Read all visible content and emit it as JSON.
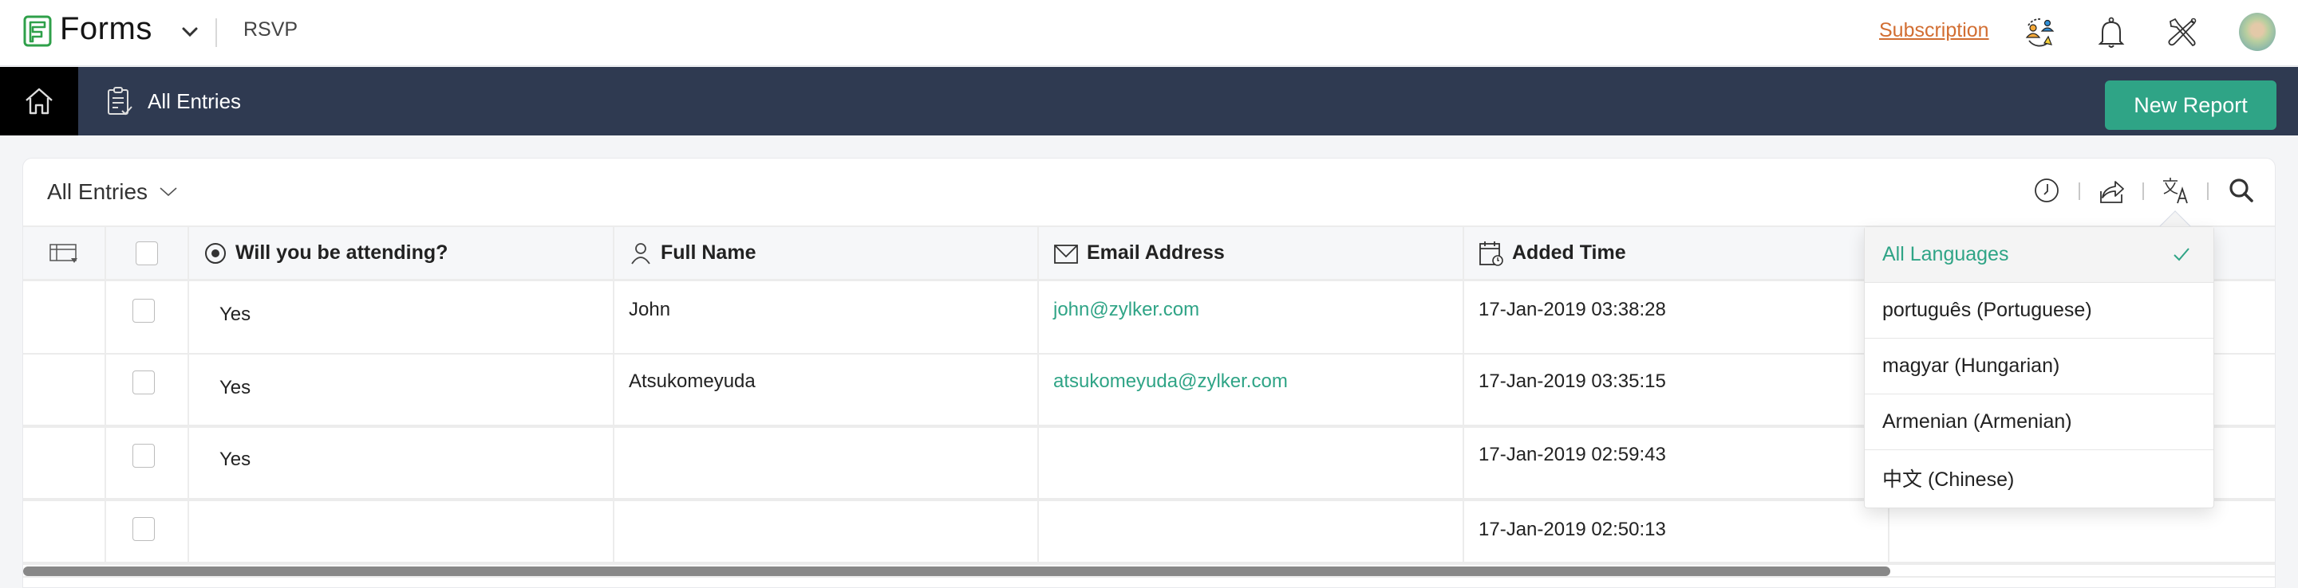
{
  "topbar": {
    "brand": "Forms",
    "form_name": "RSVP",
    "subscription_link": "Subscription",
    "icons": [
      "logo-icon",
      "chevron-down-icon",
      "user-switch-icon",
      "bell-icon",
      "tools-icon",
      "avatar"
    ]
  },
  "navbar": {
    "home_icon": "home-icon",
    "section_label": "All Entries",
    "section_icon": "clipboard-check-icon",
    "new_report_label": "New Report"
  },
  "card": {
    "view_title": "All Entries",
    "toolbar_icons": [
      "history-icon",
      "export-icon",
      "translate-icon",
      "search-icon"
    ]
  },
  "table": {
    "columns": [
      {
        "label": "Will you be attending?",
        "icon": "radio-icon"
      },
      {
        "label": "Full Name",
        "icon": "person-icon"
      },
      {
        "label": "Email Address",
        "icon": "envelope-icon"
      },
      {
        "label": "Added Time",
        "icon": "calendar-clock-icon"
      }
    ],
    "rows": [
      {
        "attending": "Yes",
        "name": "John",
        "email": "john@zylker.com",
        "added": "17-Jan-2019 03:38:28"
      },
      {
        "attending": "Yes",
        "name": "Atsukomeyuda",
        "email": "atsukomeyuda@zylker.com",
        "added": "17-Jan-2019 03:35:15"
      },
      {
        "attending": "Yes",
        "name": "",
        "email": "",
        "added": "17-Jan-2019 02:59:43"
      },
      {
        "attending": "",
        "name": "",
        "email": "",
        "added": "17-Jan-2019 02:50:13"
      }
    ]
  },
  "language_dropdown": {
    "items": [
      {
        "label": "All Languages",
        "selected": true
      },
      {
        "label": "português (Portuguese)",
        "selected": false
      },
      {
        "label": "magyar (Hungarian)",
        "selected": false
      },
      {
        "label": "Armenian (Armenian)",
        "selected": false
      },
      {
        "label": "中文 (Chinese)",
        "selected": false
      }
    ]
  },
  "colors": {
    "accent": "#2fa486",
    "nav_bg": "#2f3a51",
    "subscription": "#d26e32"
  }
}
